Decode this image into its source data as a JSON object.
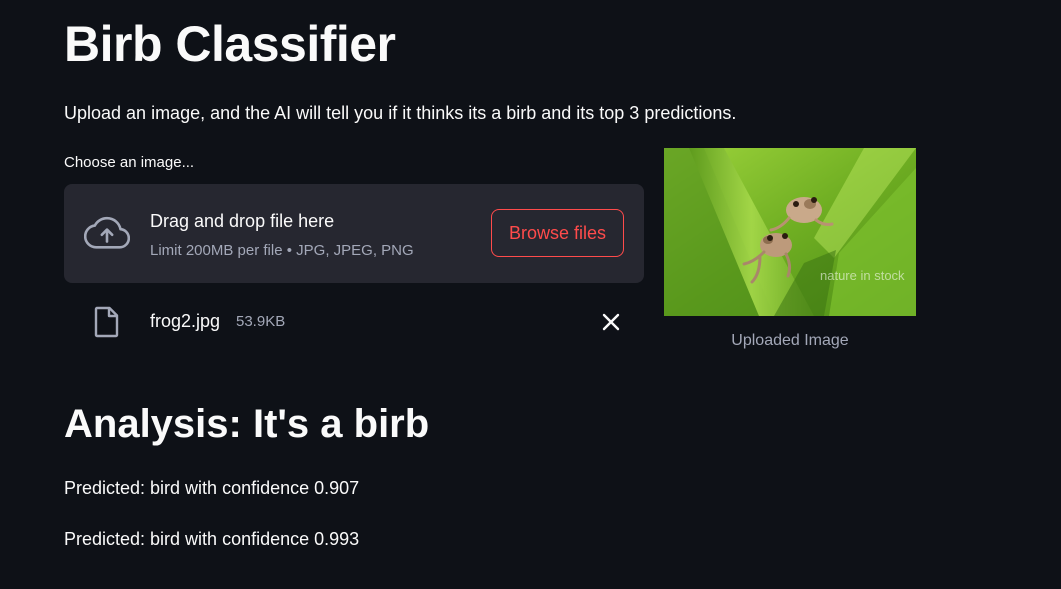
{
  "header": {
    "title": "Birb Classifier",
    "subtitle": "Upload an image, and the AI will tell you if it thinks its a birb and its top 3 predictions."
  },
  "uploader": {
    "label": "Choose an image...",
    "drop_title": "Drag and drop file here",
    "drop_limit": "Limit 200MB per file • JPG, JPEG, PNG",
    "browse_label": "Browse files",
    "accent_color": "#ff4b4b"
  },
  "uploaded_file": {
    "name": "frog2.jpg",
    "size": "53.9KB",
    "icon": "file-icon",
    "remove_icon": "close-icon"
  },
  "image": {
    "caption": "Uploaded Image",
    "watermark": "nature in stock"
  },
  "analysis": {
    "heading": "Analysis: It's a birb",
    "predictions": [
      "Predicted: bird with confidence 0.907",
      "Predicted: bird with confidence 0.993"
    ]
  },
  "theme": {
    "background": "#0e1117",
    "surface": "#262730",
    "text": "#fafafa",
    "muted": "#a3a8b8"
  }
}
